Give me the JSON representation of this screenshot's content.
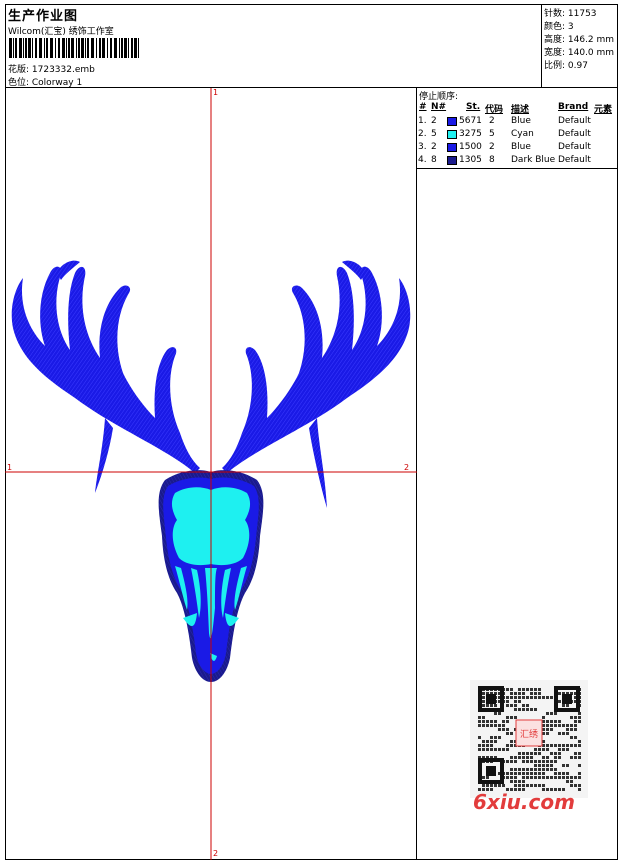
{
  "header": {
    "title": "生产作业图",
    "studio": "Wilcom(汇宝) 绣饰工作室",
    "design_label": "花版: 1723332.emb",
    "colorway_label": "色位: Colorway 1"
  },
  "stats": {
    "stitches": "针数: 11753",
    "colors": "颜色: 3",
    "height": "高度: 146.2 mm",
    "width": "宽度: 140.0 mm",
    "scale": "比例: 0.97"
  },
  "stop_sequence": {
    "title": "停止顺序:",
    "columns": [
      "#",
      "N#",
      "St.",
      "代码",
      "描述",
      "Brand",
      "元素"
    ],
    "rows": [
      {
        "num": "1.",
        "n": "2",
        "color": "#1a1ae6",
        "st": "5671",
        "code": "2",
        "desc": "Blue",
        "brand": "Default"
      },
      {
        "num": "2.",
        "n": "5",
        "color": "#1ef0f0",
        "st": "3275",
        "code": "5",
        "desc": "Cyan",
        "brand": "Default"
      },
      {
        "num": "3.",
        "n": "2",
        "color": "#1a1ae6",
        "st": "1500",
        "code": "2",
        "desc": "Blue",
        "brand": "Default"
      },
      {
        "num": "4.",
        "n": "8",
        "color": "#1a1a8c",
        "st": "1305",
        "code": "8",
        "desc": "Dark Blue",
        "brand": "Default"
      }
    ]
  },
  "axes": {
    "top": "1",
    "bottom": "2",
    "left": "1",
    "right": "2"
  },
  "colors": {
    "blue": "#1a1ae6",
    "cyan": "#1ef0f0",
    "dark_blue": "#1a1a8c",
    "axis_red": "#cc0000"
  },
  "watermark": {
    "brand": "6xiu.com",
    "seal_chars": "汇绣"
  }
}
